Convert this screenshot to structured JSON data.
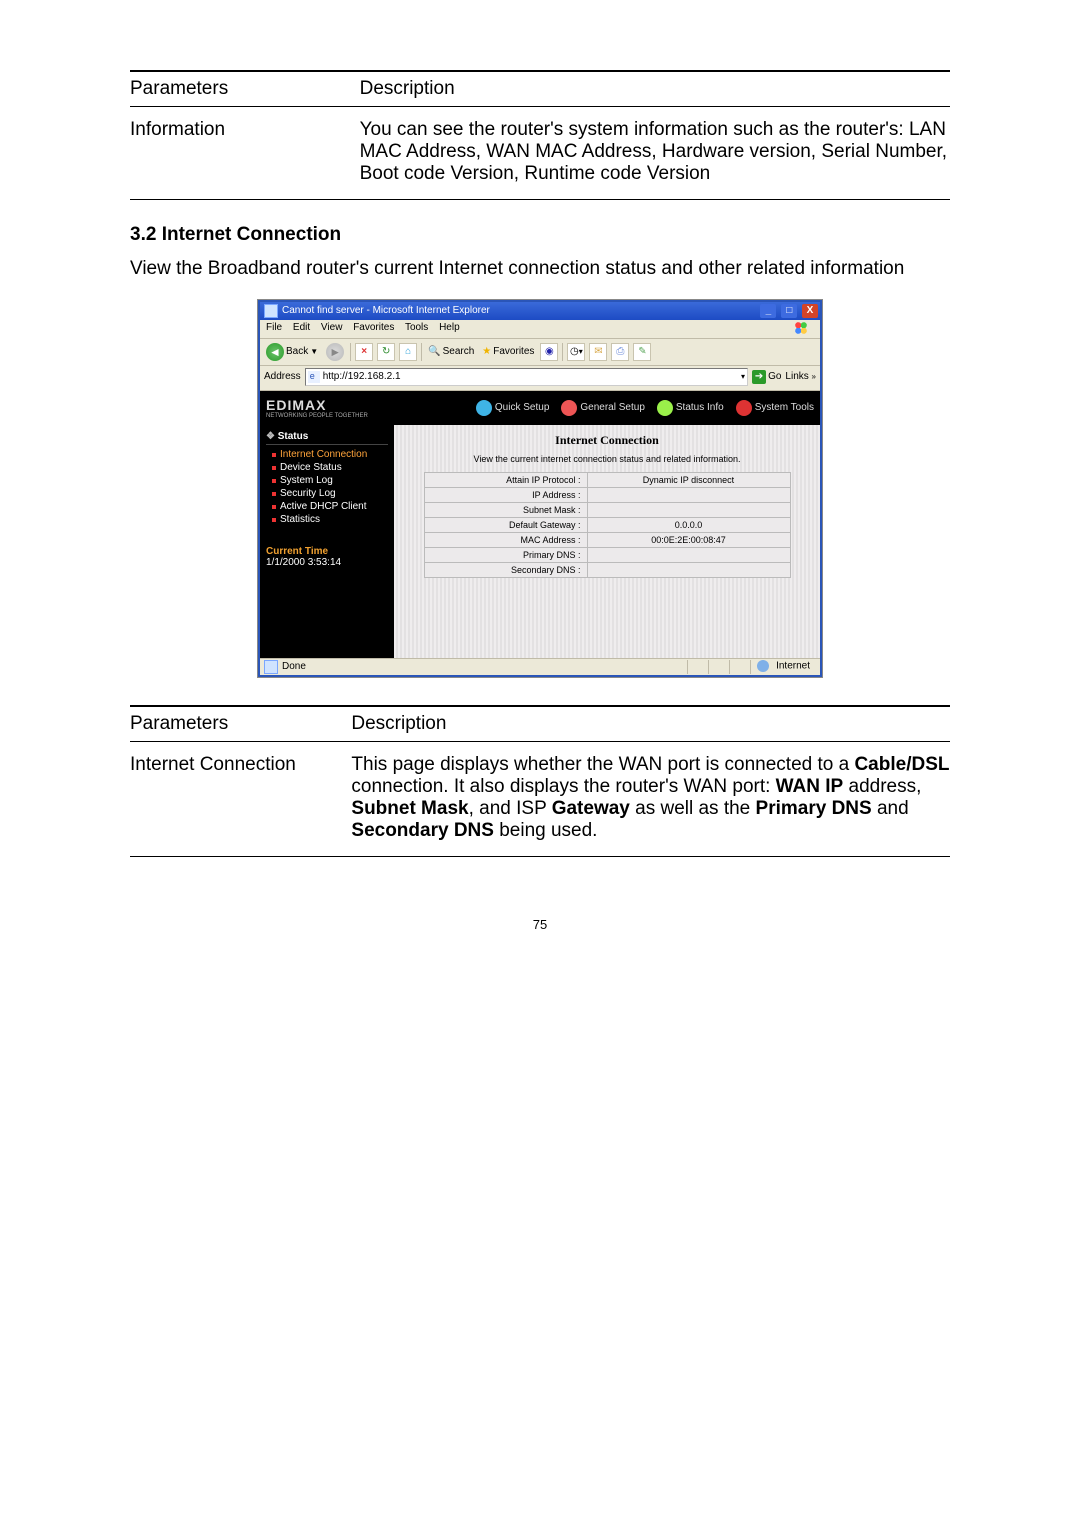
{
  "page_number": "75",
  "table1": {
    "h_param": "Parameters",
    "h_desc": "Description",
    "r1_param": "Information",
    "r1_desc": "You can see the router's system information such as the router's: LAN MAC Address, WAN MAC Address, Hardware version, Serial Number, Boot code Version, Runtime code Version"
  },
  "section": {
    "heading": "3.2 Internet Connection",
    "para": "View the Broadband router's current Internet connection status and other related information"
  },
  "ie": {
    "title": "Cannot find server - Microsoft Internet Explorer",
    "menu": {
      "file": "File",
      "edit": "Edit",
      "view": "View",
      "fav": "Favorites",
      "tools": "Tools",
      "help": "Help"
    },
    "tb": {
      "back": "Back",
      "search": "Search",
      "favorites": "Favorites"
    },
    "addr_label": "Address",
    "addr_value": "http://192.168.2.1",
    "go": "Go",
    "links": "Links",
    "status_done": "Done",
    "status_zone": "Internet"
  },
  "router": {
    "logo": "EDIMAX",
    "logo_sub": "NETWORKING PEOPLE TOGETHER",
    "nav": {
      "quick": "Quick Setup",
      "general": "General Setup",
      "status": "Status Info",
      "tools": "System Tools"
    },
    "side_head": "Status",
    "side_items": [
      "Internet Connection",
      "Device Status",
      "System Log",
      "Security Log",
      "Active DHCP Client",
      "Statistics"
    ],
    "ct_label": "Current Time",
    "ct_value": "1/1/2000 3:53:14",
    "panel_title": "Internet Connection",
    "panel_sub": "View the current internet connection status and related information.",
    "rows": [
      {
        "k": "Attain IP Protocol :",
        "v": "Dynamic IP disconnect"
      },
      {
        "k": "IP Address :",
        "v": ""
      },
      {
        "k": "Subnet Mask :",
        "v": ""
      },
      {
        "k": "Default Gateway :",
        "v": "0.0.0.0"
      },
      {
        "k": "MAC Address :",
        "v": "00:0E:2E:00:08:47"
      },
      {
        "k": "Primary DNS :",
        "v": ""
      },
      {
        "k": "Secondary DNS :",
        "v": ""
      }
    ]
  },
  "table2": {
    "h_param": "Parameters",
    "h_desc": "Description",
    "r1_param": "Internet Connection",
    "r1_a": "This page displays whether the WAN port is connected to a ",
    "r1_b": "Cable/DSL",
    "r1_c": " connection. It also displays the router's WAN port: ",
    "r1_d": "WAN IP",
    "r1_e": " address, ",
    "r1_f": "Subnet Mask",
    "r1_g": ", and ISP ",
    "r1_h": "Gateway",
    "r1_i": " as well as the ",
    "r1_j": "Primary DNS",
    "r1_k": " and ",
    "r1_l": "Secondary DNS",
    "r1_m": " being used."
  }
}
